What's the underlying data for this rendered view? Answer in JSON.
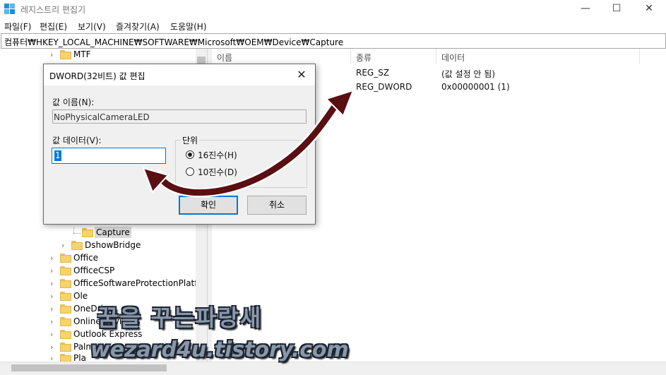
{
  "window": {
    "title": "레지스트리 편집기",
    "minimize_glyph": "—",
    "maximize_glyph": "☐",
    "close_glyph": "✕"
  },
  "menu": [
    "파일(F)",
    "편집(E)",
    "보기(V)",
    "즐겨찾기(A)",
    "도움말(H)"
  ],
  "address": "컴퓨터₩HKEY_LOCAL_MACHINE₩SOFTWARE₩Microsoft₩OEM₩Device₩Capture",
  "tree": {
    "items": [
      {
        "label": "MTF",
        "chevron": "›"
      },
      {
        "label": "Capture",
        "chevron": ""
      },
      {
        "label": "DshowBridge",
        "chevron": "›"
      },
      {
        "label": "Office",
        "chevron": "›"
      },
      {
        "label": "OfficeCSP",
        "chevron": "›"
      },
      {
        "label": "OfficeSoftwareProtectionPlatfor",
        "chevron": "›"
      },
      {
        "label": "Ole",
        "chevron": "›"
      },
      {
        "label": "OneDrive",
        "chevron": "›"
      },
      {
        "label": "OnlineProviders",
        "chevron": "›"
      },
      {
        "label": "Outlook Express",
        "chevron": "›"
      },
      {
        "label": "Palm",
        "chevron": "›"
      },
      {
        "label": "Pla",
        "chevron": "›"
      }
    ]
  },
  "list": {
    "columns": {
      "name": "이름",
      "type": "종류",
      "data": "데이터"
    },
    "rows": [
      {
        "type": "REG_SZ",
        "data": "(값 설정 안 됨)"
      },
      {
        "type": "REG_DWORD",
        "data": "0x00000001 (1)"
      }
    ]
  },
  "dialog": {
    "title": "DWORD(32비트) 값 편집",
    "name_label": "값 이름(N):",
    "name_value": "NoPhysicalCameraLED",
    "data_label": "값 데이터(V):",
    "data_value": "1",
    "base_label": "단위",
    "hex_label": "16진수(H)",
    "dec_label": "10진수(D)",
    "ok_label": "확인",
    "cancel_label": "취소",
    "close_glyph": "✕"
  },
  "watermark": {
    "line1": "꿈을 꾸는파랑새",
    "line2": "wezard4u.tistory.com"
  },
  "colors": {
    "accent": "#0078d7",
    "arrow": "#5a0f12",
    "folder": "#f6d36d"
  }
}
